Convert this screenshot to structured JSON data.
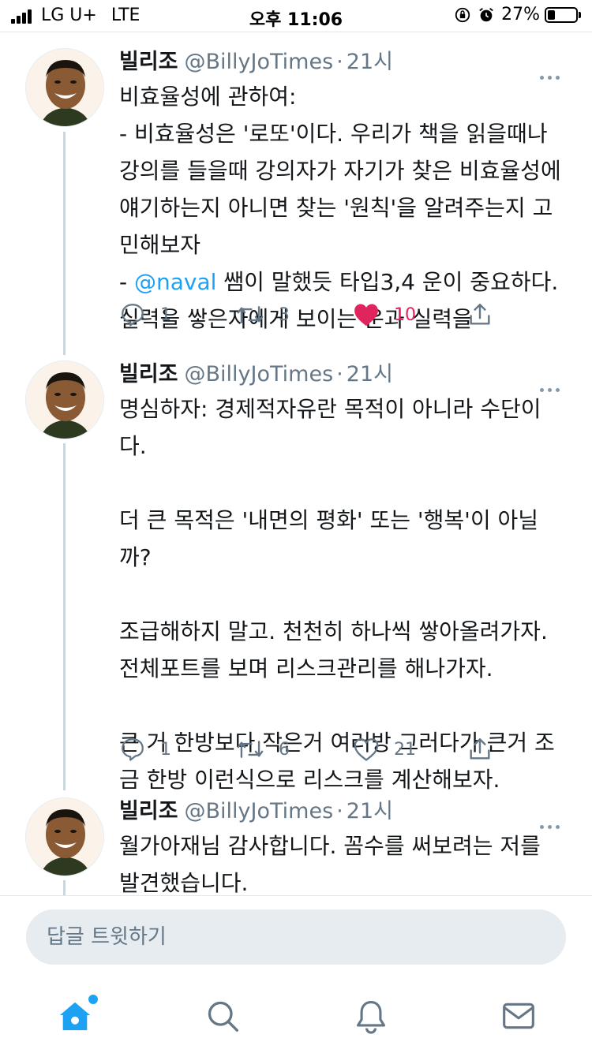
{
  "status_bar": {
    "carrier": "LG U+",
    "network": "LTE",
    "time": "오후 11:06",
    "battery_percent": "27%",
    "battery_level": 0.27
  },
  "colors": {
    "accent": "#1da1f2",
    "like": "#e0245e",
    "muted": "#657786"
  },
  "tweets": [
    {
      "author_name": "빌리조",
      "author_handle": "@BillyJoTimes",
      "separator": "·",
      "time": "21시",
      "text_before_mention": "비효율성에 관하여:\n- 비효율성은 '로또'이다. 우리가 책을 읽을때나\n강의를 들을때 강의자가 자기가 찾은 비효율성에\n얘기하는지 아니면 찾는 '원칙'을 알려주는지 고\n민해보자\n- ",
      "mention": "@naval",
      "text_after_mention": " 쌤이 말했듯 타입3,4 운이 중요하다.\n실력을 쌓은자에게 보이는 운과 실력을",
      "replies": "1",
      "retweets": "3",
      "likes": "10",
      "liked": true
    },
    {
      "author_name": "빌리조",
      "author_handle": "@BillyJoTimes",
      "separator": "·",
      "time": "21시",
      "text": "명심하자: 경제적자유란 목적이 아니라 수단이\n다.\n\n더 큰 목적은 '내면의 평화' 또는 '행복'이 아닐\n까?\n\n조급해하지 말고. 천천히 하나씩 쌓아올려가자.\n전체포트를 보며 리스크관리를 해나가자.\n\n큰 거 한방보다 작은거 여러방 그러다가 큰거 조\n금 한방 이런식으로 리스크를 계산해보자.",
      "replies": "1",
      "retweets": "6",
      "likes": "21",
      "liked": false
    },
    {
      "author_name": "빌리조",
      "author_handle": "@BillyJoTimes",
      "separator": "·",
      "time": "21시",
      "text": "월가아재님 감사합니다. 꼼수를 써보려는 저를\n발견했습니다."
    }
  ],
  "reply_box": {
    "placeholder": "답글 트윗하기"
  },
  "tabbar": {
    "items": [
      "home-icon",
      "search-icon",
      "notifications-icon",
      "messages-icon"
    ],
    "home_has_new": true
  }
}
